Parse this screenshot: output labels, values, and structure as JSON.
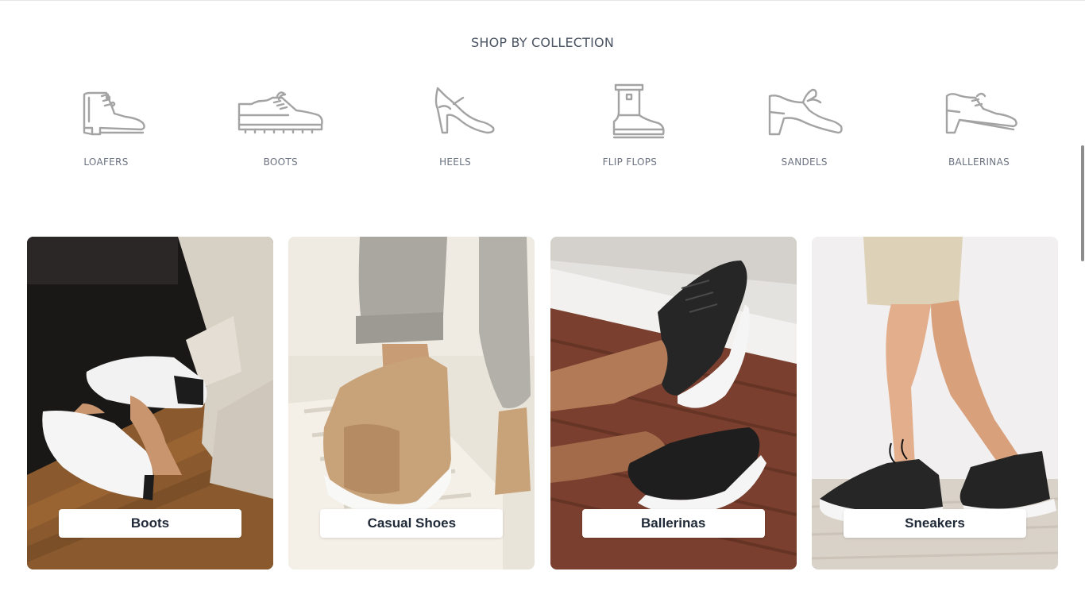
{
  "section": {
    "title": "SHOP BY COLLECTION"
  },
  "collections": [
    {
      "label": "LOAFERS",
      "icon": "ankle-boot-icon"
    },
    {
      "label": "BOOTS",
      "icon": "sneaker-icon"
    },
    {
      "label": "HEELS",
      "icon": "high-heel-icon"
    },
    {
      "label": "FLIP FLOPS",
      "icon": "rain-boot-icon"
    },
    {
      "label": "SANDELS",
      "icon": "block-heel-icon"
    },
    {
      "label": "BALLERINAS",
      "icon": "oxford-shoe-icon"
    }
  ],
  "cards": [
    {
      "label": "Boots"
    },
    {
      "label": "Casual Shoes"
    },
    {
      "label": "Ballerinas"
    },
    {
      "label": "Sneakers"
    }
  ],
  "colors": {
    "title_text": "#4b5563",
    "icon_stroke": "#a3a3a3",
    "label_text": "#6b7280",
    "card_label_text": "#1f2937"
  }
}
